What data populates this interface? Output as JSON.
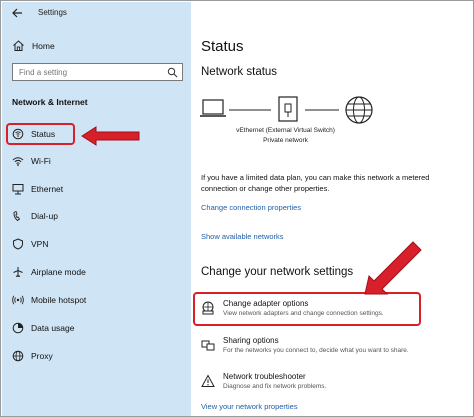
{
  "window": {
    "title": "Settings"
  },
  "sidebar": {
    "home_label": "Home",
    "search_placeholder": "Find a setting",
    "section_label": "Network & Internet",
    "items": [
      {
        "label": "Status",
        "icon": "status-icon",
        "selected": true
      },
      {
        "label": "Wi-Fi",
        "icon": "wifi-icon"
      },
      {
        "label": "Ethernet",
        "icon": "ethernet-icon"
      },
      {
        "label": "Dial-up",
        "icon": "dialup-icon"
      },
      {
        "label": "VPN",
        "icon": "vpn-icon"
      },
      {
        "label": "Airplane mode",
        "icon": "airplane-icon"
      },
      {
        "label": "Mobile hotspot",
        "icon": "hotspot-icon"
      },
      {
        "label": "Data usage",
        "icon": "data-usage-icon"
      },
      {
        "label": "Proxy",
        "icon": "globe-icon"
      }
    ]
  },
  "main": {
    "title": "Status",
    "network_status_heading": "Network status",
    "adapter_name": "vEthernet (External Virtual Switch)",
    "adapter_sub": "Private network",
    "info_text": "If you have a limited data plan, you can make this network a metered connection or change other properties.",
    "link_change_connection": "Change connection properties",
    "link_show_networks": "Show available networks",
    "change_heading": "Change your network settings",
    "options": [
      {
        "title": "Change adapter options",
        "desc": "View network adapters and change connection settings.",
        "icon": "adapter-icon"
      },
      {
        "title": "Sharing options",
        "desc": "For the networks you connect to, decide what you want to share.",
        "icon": "sharing-icon"
      },
      {
        "title": "Network troubleshooter",
        "desc": "Diagnose and fix network problems.",
        "icon": "warning-icon"
      }
    ],
    "link_view_properties": "View your network properties"
  },
  "colors": {
    "sidebar_bg": "#cfe4f4",
    "link": "#1f5fa8",
    "annotation_red": "#d8202a"
  }
}
